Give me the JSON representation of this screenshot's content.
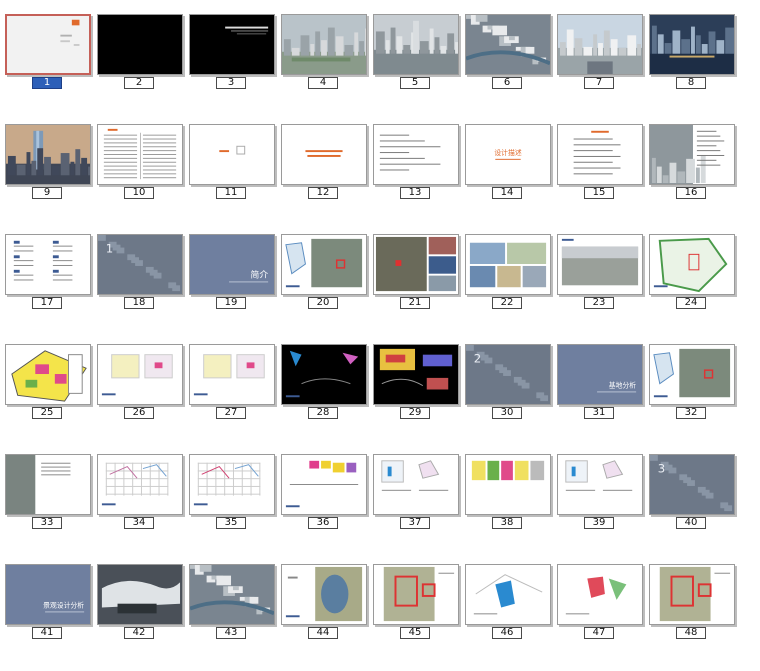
{
  "slides": [
    {
      "n": "1",
      "kind": "cover"
    },
    {
      "n": "2",
      "kind": "black"
    },
    {
      "n": "3",
      "kind": "black-title"
    },
    {
      "n": "4",
      "kind": "aerial"
    },
    {
      "n": "5",
      "kind": "aerial-tower"
    },
    {
      "n": "6",
      "kind": "aerial-top"
    },
    {
      "n": "7",
      "kind": "street"
    },
    {
      "n": "8",
      "kind": "night-water"
    },
    {
      "n": "9",
      "kind": "tower-sunset"
    },
    {
      "n": "10",
      "kind": "text-columns"
    },
    {
      "n": "11",
      "kind": "blank-small"
    },
    {
      "n": "12",
      "kind": "orange-title"
    },
    {
      "n": "13",
      "kind": "text-lines"
    },
    {
      "n": "14",
      "kind": "orange-title"
    },
    {
      "n": "15",
      "kind": "orange-list"
    },
    {
      "n": "16",
      "kind": "aerial-text"
    },
    {
      "n": "17",
      "kind": "index"
    },
    {
      "n": "18",
      "kind": "chapter-photo"
    },
    {
      "n": "19",
      "kind": "blue-chapter"
    },
    {
      "n": "20",
      "kind": "map-site"
    },
    {
      "n": "21",
      "kind": "photo-collage"
    },
    {
      "n": "22",
      "kind": "photo-collage-light"
    },
    {
      "n": "23",
      "kind": "wide-photo"
    },
    {
      "n": "24",
      "kind": "plan-green"
    },
    {
      "n": "25",
      "kind": "colored-plan"
    },
    {
      "n": "26",
      "kind": "diagram-pair"
    },
    {
      "n": "27",
      "kind": "diagram-pair"
    },
    {
      "n": "28",
      "kind": "dark-diagram"
    },
    {
      "n": "29",
      "kind": "dark-charts"
    },
    {
      "n": "30",
      "kind": "chapter-photo"
    },
    {
      "n": "31",
      "kind": "blue-chapter"
    },
    {
      "n": "32",
      "kind": "map-site"
    },
    {
      "n": "33",
      "kind": "map-text"
    },
    {
      "n": "34",
      "kind": "grid-diagram"
    },
    {
      "n": "35",
      "kind": "grid-diagram"
    },
    {
      "n": "36",
      "kind": "color-blocks"
    },
    {
      "n": "37",
      "kind": "mixed-diagram"
    },
    {
      "n": "38",
      "kind": "color-diagram"
    },
    {
      "n": "39",
      "kind": "mixed-diagram"
    },
    {
      "n": "40",
      "kind": "chapter-photo"
    },
    {
      "n": "41",
      "kind": "blue-chapter"
    },
    {
      "n": "42",
      "kind": "render-roof"
    },
    {
      "n": "43",
      "kind": "aerial-top"
    },
    {
      "n": "44",
      "kind": "site-plan"
    },
    {
      "n": "45",
      "kind": "site-plan-red"
    },
    {
      "n": "46",
      "kind": "sketch-blue"
    },
    {
      "n": "47",
      "kind": "sketch-red"
    },
    {
      "n": "48",
      "kind": "site-plan-red"
    }
  ],
  "selected": "1",
  "chapter_text": {
    "18": "1",
    "19": "简介",
    "30": "2",
    "31": "基地分析",
    "40": "3",
    "41": "景观设计分析",
    "14": "设计描述"
  },
  "colors": {
    "selection_fill": "#2d5fb8",
    "selection_border": "#c56058",
    "chapter_blue": "#6f7f9f",
    "accent_orange": "#e06a2c"
  }
}
